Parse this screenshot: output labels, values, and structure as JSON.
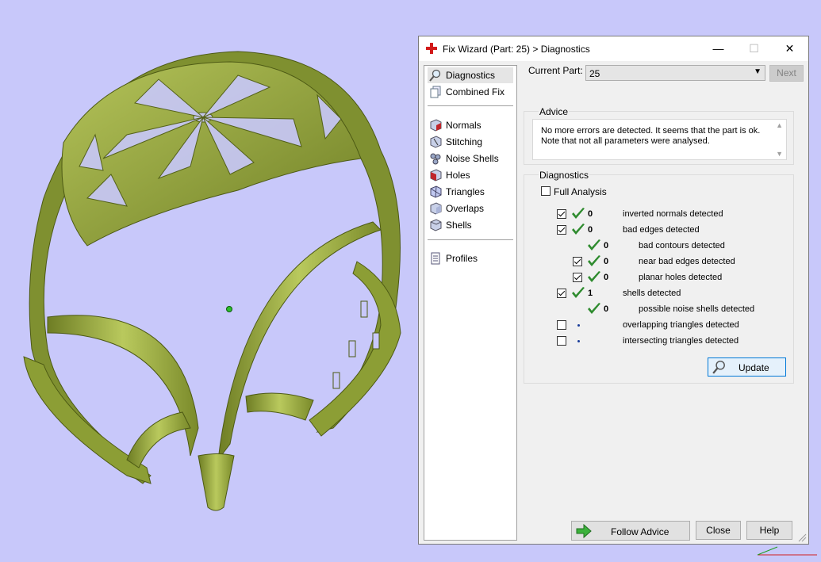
{
  "window": {
    "title": "Fix Wizard (Part: 25) > Diagnostics",
    "minimize_glyph": "—",
    "maximize_glyph": "☐",
    "close_glyph": "✕"
  },
  "nav": {
    "items": [
      {
        "label": "Diagnostics",
        "icon": "magnifier-icon"
      },
      {
        "label": "Combined Fix",
        "icon": "pages-icon"
      },
      {
        "label": "Normals",
        "icon": "cube-normals-icon"
      },
      {
        "label": "Stitching",
        "icon": "cube-stitching-icon"
      },
      {
        "label": "Noise Shells",
        "icon": "noise-shells-icon"
      },
      {
        "label": "Holes",
        "icon": "cube-holes-icon"
      },
      {
        "label": "Triangles",
        "icon": "cube-triangles-icon"
      },
      {
        "label": "Overlaps",
        "icon": "cube-overlaps-icon"
      },
      {
        "label": "Shells",
        "icon": "cube-shells-icon"
      },
      {
        "label": "Profiles",
        "icon": "document-icon"
      }
    ]
  },
  "current_part": {
    "label": "Current Part:",
    "value": "25",
    "next_label": "Next"
  },
  "advice": {
    "group_label": "Advice",
    "text": "No more errors are detected. It seems that the part is ok. Note that not all parameters were analysed."
  },
  "diagnostics": {
    "group_label": "Diagnostics",
    "full_analysis_label": "Full Analysis",
    "rows": [
      {
        "checked": true,
        "status": "ok",
        "count": "0",
        "label": "inverted normals detected"
      },
      {
        "checked": true,
        "status": "ok",
        "count": "0",
        "label": "bad edges detected"
      },
      {
        "checked": null,
        "status": "ok",
        "count": "0",
        "label": "bad contours detected"
      },
      {
        "checked": true,
        "status": "ok",
        "count": "0",
        "label": "near bad edges detected"
      },
      {
        "checked": true,
        "status": "ok",
        "count": "0",
        "label": "planar holes detected"
      },
      {
        "checked": true,
        "status": "ok",
        "count": "1",
        "label": "shells detected"
      },
      {
        "checked": null,
        "status": "ok",
        "count": "0",
        "label": "possible noise shells detected"
      },
      {
        "checked": false,
        "status": "not-analysed",
        "count": "",
        "label": "overlapping triangles detected"
      },
      {
        "checked": false,
        "status": "not-analysed",
        "count": "",
        "label": "intersecting triangles detected"
      }
    ],
    "update_label": "Update"
  },
  "footer": {
    "follow_advice_label": "Follow Advice",
    "close_label": "Close",
    "help_label": "Help"
  },
  "colors": {
    "background": "#c8c8fa",
    "model": "#8fa33a",
    "check": "#2e8b2e"
  }
}
